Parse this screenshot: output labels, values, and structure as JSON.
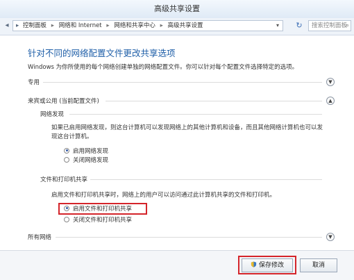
{
  "window": {
    "title": "高级共享设置"
  },
  "address_bar": {
    "crumbs": [
      "控制面板",
      "网络和 Internet",
      "网络和共享中心",
      "高级共享设置"
    ],
    "search_placeholder": "搜索控制面板"
  },
  "main": {
    "heading": "针对不同的网络配置文件更改共享选项",
    "description": "Windows 为你所使用的每个网络创建单独的网络配置文件。你可以针对每个配置文件选择特定的选项。",
    "profiles": {
      "private": {
        "label": "专用"
      },
      "guest": {
        "label": "来宾或公用 (当前配置文件)",
        "network_discovery": {
          "label": "网络发现",
          "para": "如果已启用网络发现，则这台计算机可以发现网络上的其他计算机和设备，而且其他网络计算机也可以发现这台计算机。",
          "on_label": "启用网络发现",
          "off_label": "关闭网络发现",
          "selected": "on"
        },
        "file_printer_sharing": {
          "label": "文件和打印机共享",
          "para": "启用文件和打印机共享时，网络上的用户可以访问通过此计算机共享的文件和打印机。",
          "on_label": "启用文件和打印机共享",
          "off_label": "关闭文件和打印机共享",
          "selected": "on"
        }
      },
      "all": {
        "label": "所有网络"
      }
    }
  },
  "footer": {
    "save_label": "保存修改",
    "cancel_label": "取消"
  },
  "colors": {
    "heading": "#1f5fa8",
    "highlight": "#d4242a"
  }
}
